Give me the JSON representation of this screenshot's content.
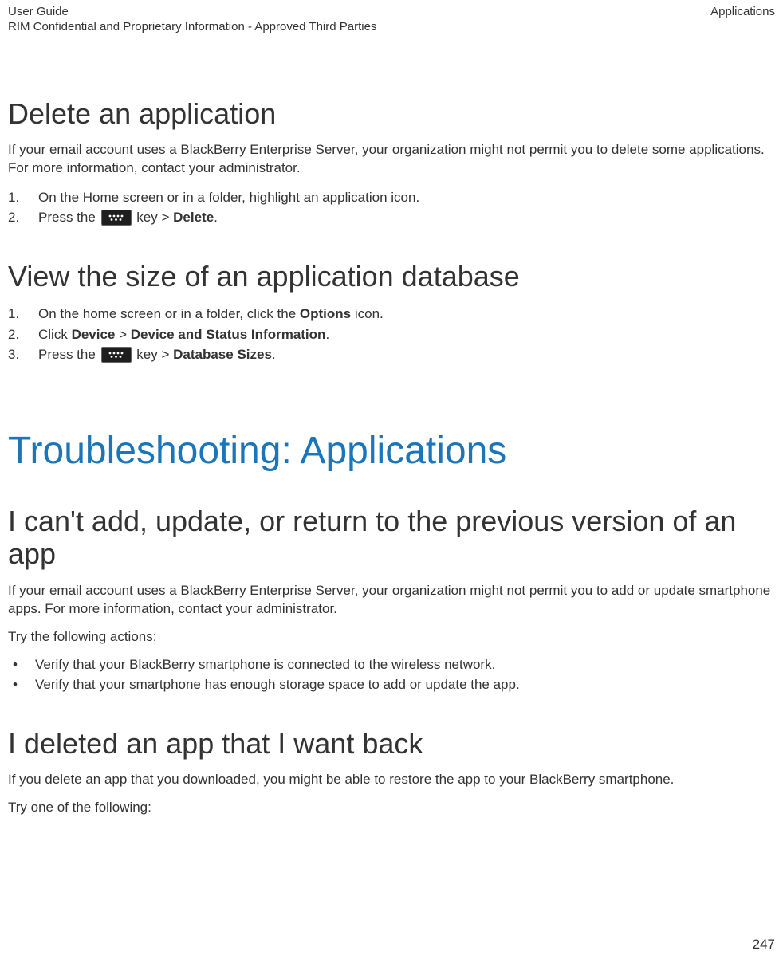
{
  "header": {
    "left_line1": "User Guide",
    "left_line2": "RIM Confidential and Proprietary Information - Approved Third Parties",
    "right": "Applications"
  },
  "section1": {
    "title": "Delete an application",
    "intro": "If your email account uses a BlackBerry Enterprise Server, your organization might not permit you to delete some applications. For more information, contact your administrator.",
    "step1": "On the Home screen or in a folder, highlight an application icon.",
    "step2_a": "Press the ",
    "step2_b": " key > ",
    "step2_c": "Delete",
    "step2_d": "."
  },
  "section2": {
    "title": "View the size of an application database",
    "s1_a": "On the home screen or in a folder, click the ",
    "s1_b": "Options",
    "s1_c": " icon.",
    "s2_a": "Click ",
    "s2_b": "Device",
    "s2_c": " > ",
    "s2_d": "Device and Status Information",
    "s2_e": ".",
    "s3_a": "Press the ",
    "s3_b": " key > ",
    "s3_c": "Database Sizes",
    "s3_d": "."
  },
  "chapter": {
    "title": "Troubleshooting: Applications"
  },
  "section3": {
    "title": "I can't add, update, or return to the previous version of an app",
    "p1": "If your email account uses a BlackBerry Enterprise Server, your organization might not permit you to add or update smartphone apps. For more information, contact your administrator.",
    "p2": "Try the following actions:",
    "b1": "Verify that your BlackBerry smartphone is connected to the wireless network.",
    "b2": "Verify that your smartphone has enough storage space to add or update the app."
  },
  "section4": {
    "title": "I deleted an app that I want back",
    "p1": "If you delete an app that you downloaded, you might be able to restore the app to your BlackBerry smartphone.",
    "p2": "Try one of the following:"
  },
  "page_number": "247"
}
